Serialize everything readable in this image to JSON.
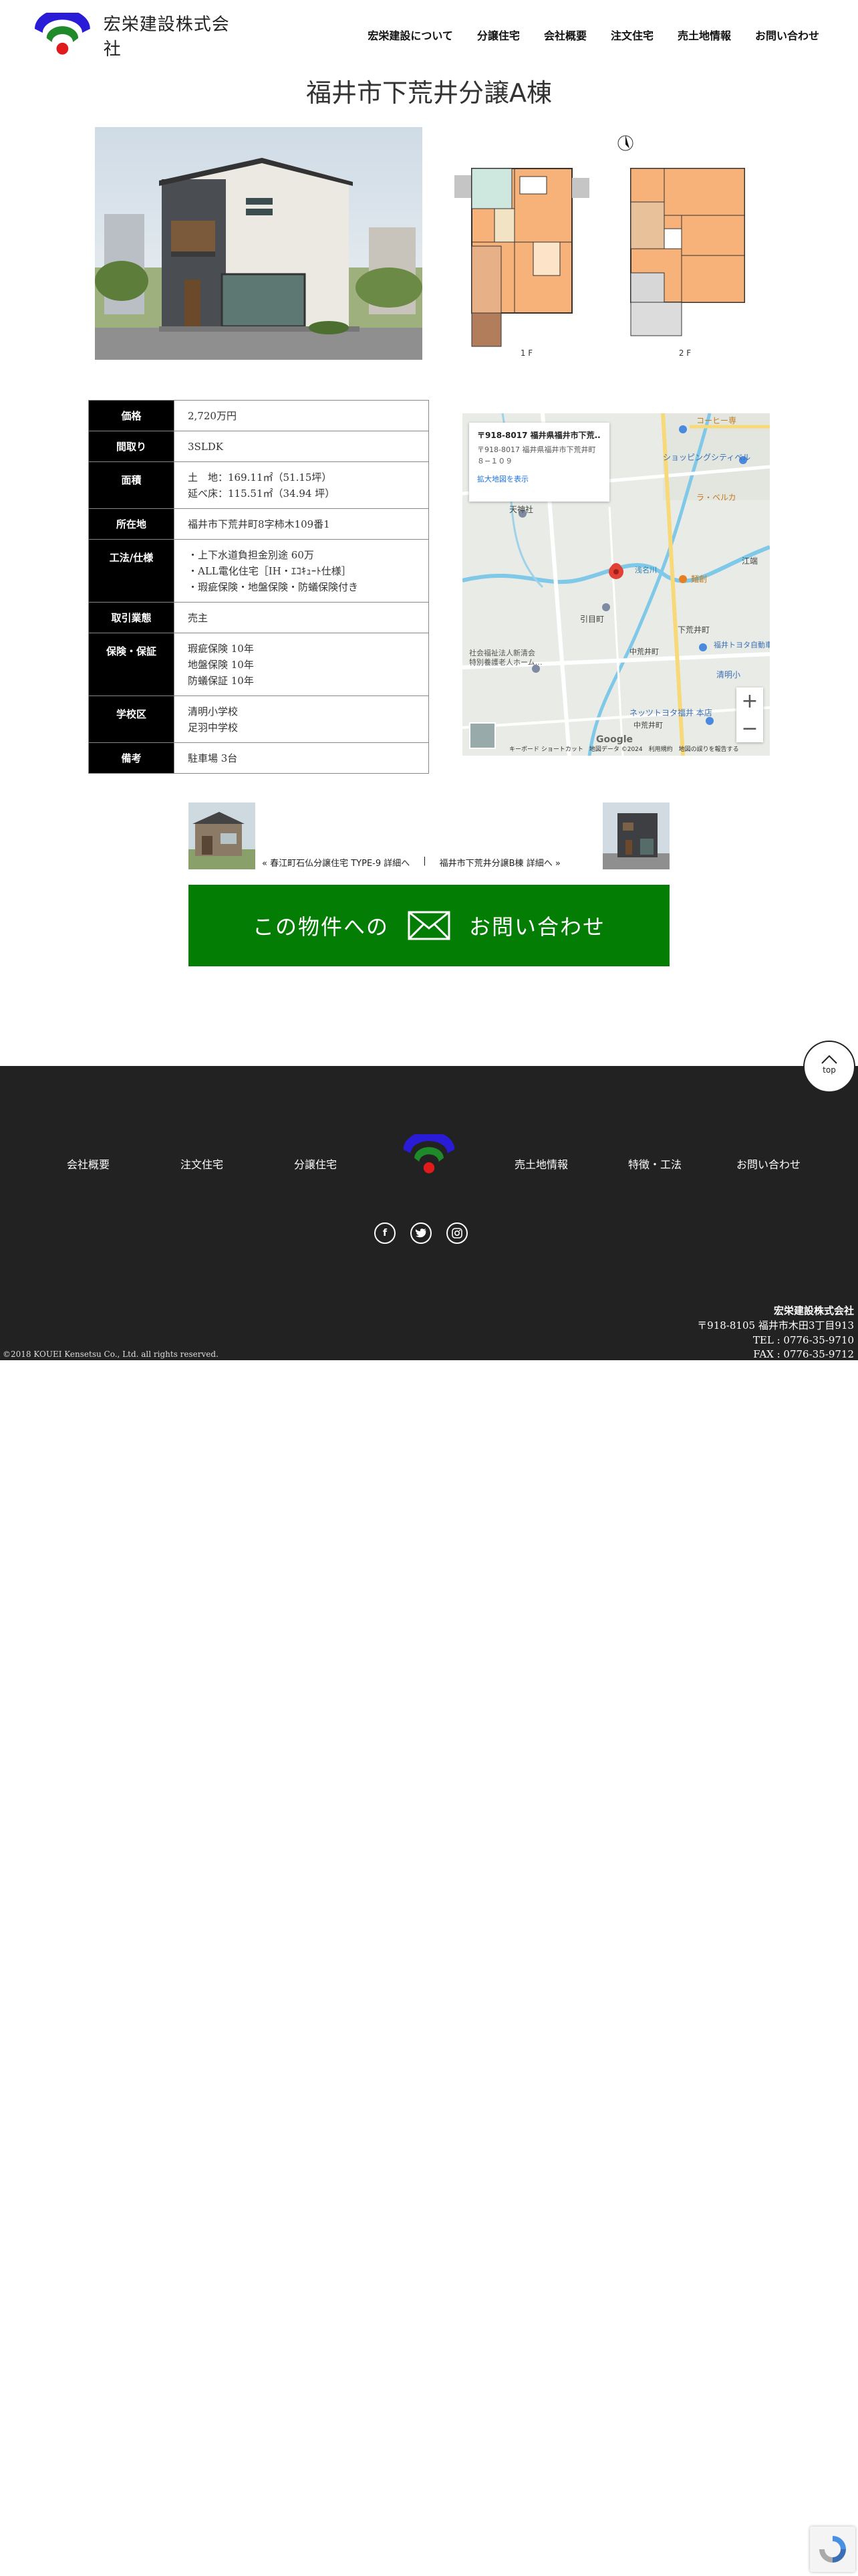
{
  "header": {
    "company_name": "宏栄建設株式会社",
    "nav": [
      "宏栄建設について",
      "分譲住宅",
      "会社概要",
      "注文住宅",
      "売土地情報",
      "お問い合わせ"
    ]
  },
  "page_title": "福井市下荒井分譲A棟",
  "floorplan_labels": [
    "1 F",
    "2 F"
  ],
  "spec": [
    {
      "label": "価格",
      "lines": [
        "2,720万円"
      ]
    },
    {
      "label": "間取り",
      "lines": [
        "3SLDK"
      ]
    },
    {
      "label": "面積",
      "lines": [
        "土　地：169.11㎡（51.15坪）",
        "延べ床：115.51㎡（34.94 坪）"
      ]
    },
    {
      "label": "所在地",
      "lines": [
        "福井市下荒井町8字柿木109番1"
      ]
    },
    {
      "label": "工法/仕様",
      "lines": [
        "・上下水道負担金別途 60万",
        "・ALL電化住宅［IH・ｴｺｷｭｰﾄ仕様］",
        "・瑕疵保険・地盤保険・防蟻保険付き"
      ]
    },
    {
      "label": "取引業態",
      "lines": [
        "売主"
      ]
    },
    {
      "label": "保険・保証",
      "lines": [
        "瑕疵保険 10年",
        "地盤保険 10年",
        "防蟻保証 10年"
      ]
    },
    {
      "label": "学校区",
      "lines": [
        "清明小学校",
        "足羽中学校"
      ]
    },
    {
      "label": "備考",
      "lines": [
        "駐車場 3台"
      ]
    }
  ],
  "map": {
    "card_title": "〒918-8017 福井県福井市下荒...",
    "card_address": "〒918-8017 福井県福井市下荒井町８−１０９",
    "card_link": "拡大地図を表示",
    "footer_text": "キーボード ショートカット　地図データ ©2024　利用規約　地図の誤りを報告する",
    "logo_text": "Google",
    "zoom_in": "+",
    "zoom_out": "−",
    "place_labels": [
      "コーヒー専",
      "ショッピングシティベル",
      "ラ・ベルカ",
      "江端",
      "天神社",
      "浅名川",
      "引目町",
      "社会福祉法人新清会",
      "特別養護老人ホーム…",
      "下荒井町",
      "福井トヨタ自動車(株) 本社",
      "清明小",
      "ネッツトヨタ福井 本店",
      "中荒井町",
      "中荒井町",
      "麺創"
    ]
  },
  "prev_link": "« 春江町石仏分譲住宅 TYPE-9 詳細へ",
  "separator": "|",
  "next_link": "福井市下荒井分譲B棟 詳細へ »",
  "cta": {
    "left": "この物件への",
    "right": "お問い合わせ"
  },
  "totop": "top",
  "footer": {
    "nav_left": [
      "会社概要",
      "注文住宅",
      "分譲住宅"
    ],
    "nav_right": [
      "売土地情報",
      "特徴・工法",
      "お問い合わせ"
    ],
    "company_name": "宏栄建設株式会社",
    "address": "〒918-8105 福井市木田3丁目913",
    "tel": "TEL : 0776-35-9710",
    "fax": "FAX : 0776-35-9712",
    "copyright": "©2018 KOUEI Kensetsu Co., Ltd. all rights reserved."
  },
  "colors": {
    "cta": "#047d04",
    "footer_bg": "#222222",
    "logo_blue": "#2a1bd6",
    "logo_green": "#1f8a2a",
    "logo_red": "#e01b1b"
  }
}
